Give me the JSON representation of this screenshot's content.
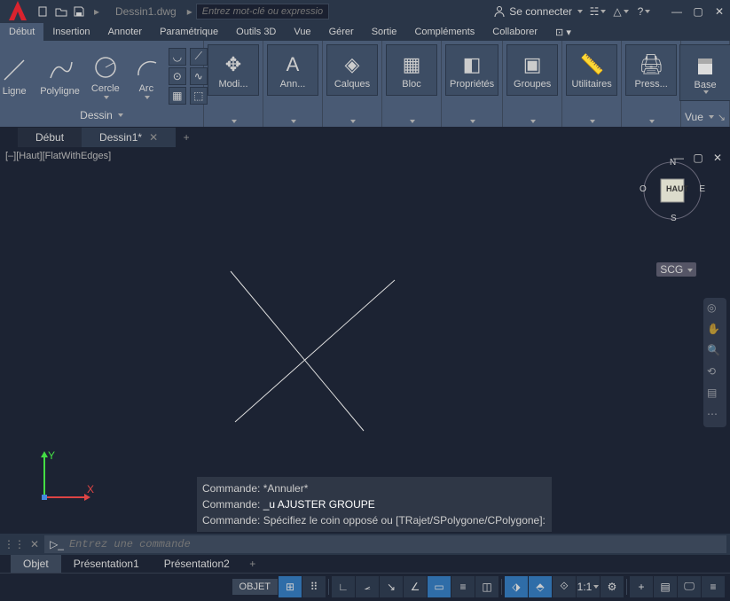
{
  "title": {
    "filename": "Dessin1.dwg",
    "search_placeholder": "Entrez mot-clé ou expression",
    "signin": "Se connecter"
  },
  "menu": {
    "tabs": [
      "Début",
      "Insertion",
      "Annoter",
      "Paramétrique",
      "Outils 3D",
      "Vue",
      "Gérer",
      "Sortie",
      "Compléments",
      "Collaborer"
    ],
    "active": 0
  },
  "ribbon": {
    "draw": {
      "ligne": "Ligne",
      "polyligne": "Polyligne",
      "cercle": "Cercle",
      "arc": "Arc",
      "panel": "Dessin"
    },
    "panels": [
      {
        "label": "Modi..."
      },
      {
        "label": "Ann..."
      },
      {
        "label": "Calques"
      },
      {
        "label": "Bloc"
      },
      {
        "label": "Propriétés"
      },
      {
        "label": "Groupes"
      },
      {
        "label": "Utilitaires"
      },
      {
        "label": "Press..."
      }
    ],
    "base": {
      "label": "Base",
      "vue": "Vue"
    }
  },
  "doc_tabs": {
    "start": "Début",
    "drawing": "Dessin1*"
  },
  "viewport": {
    "label": "[–][Haut][FlatWithEdges]",
    "cube": "HAUT",
    "scg": "SCG",
    "compass": {
      "n": "N",
      "s": "S",
      "e": "E",
      "o": "O"
    }
  },
  "cmd": {
    "h1": "Commande: *Annuler*",
    "h2_a": "Commande:",
    "h2_b": " _u AJUSTER GROUPE",
    "h3": "Commande: Spécifiez le coin opposé ou [TRajet/SPolygone/CPolygone]:",
    "placeholder": "Entrez une commande"
  },
  "layouts": {
    "model": "Objet",
    "p1": "Présentation1",
    "p2": "Présentation2"
  },
  "status": {
    "model": "OBJET",
    "scale": "1:1"
  }
}
